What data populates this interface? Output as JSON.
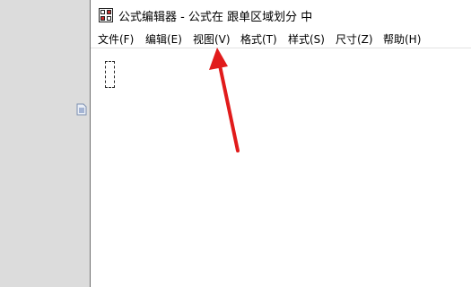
{
  "window": {
    "title": "公式编辑器 - 公式在 跟单区域划分 中"
  },
  "menu": {
    "items": [
      {
        "id": "file",
        "label": "文件(F)"
      },
      {
        "id": "edit",
        "label": "编辑(E)"
      },
      {
        "id": "view",
        "label": "视图(V)"
      },
      {
        "id": "format",
        "label": "格式(T)"
      },
      {
        "id": "style",
        "label": "样式(S)"
      },
      {
        "id": "size",
        "label": "尺寸(Z)"
      },
      {
        "id": "help",
        "label": "帮助(H)"
      }
    ]
  },
  "icons": {
    "app": "equation-editor-icon",
    "document": "document-icon",
    "annotation": "red-arrow"
  },
  "colors": {
    "arrow": "#e11b1b",
    "desktop": "#dcdcdc",
    "window": "#ffffff"
  }
}
